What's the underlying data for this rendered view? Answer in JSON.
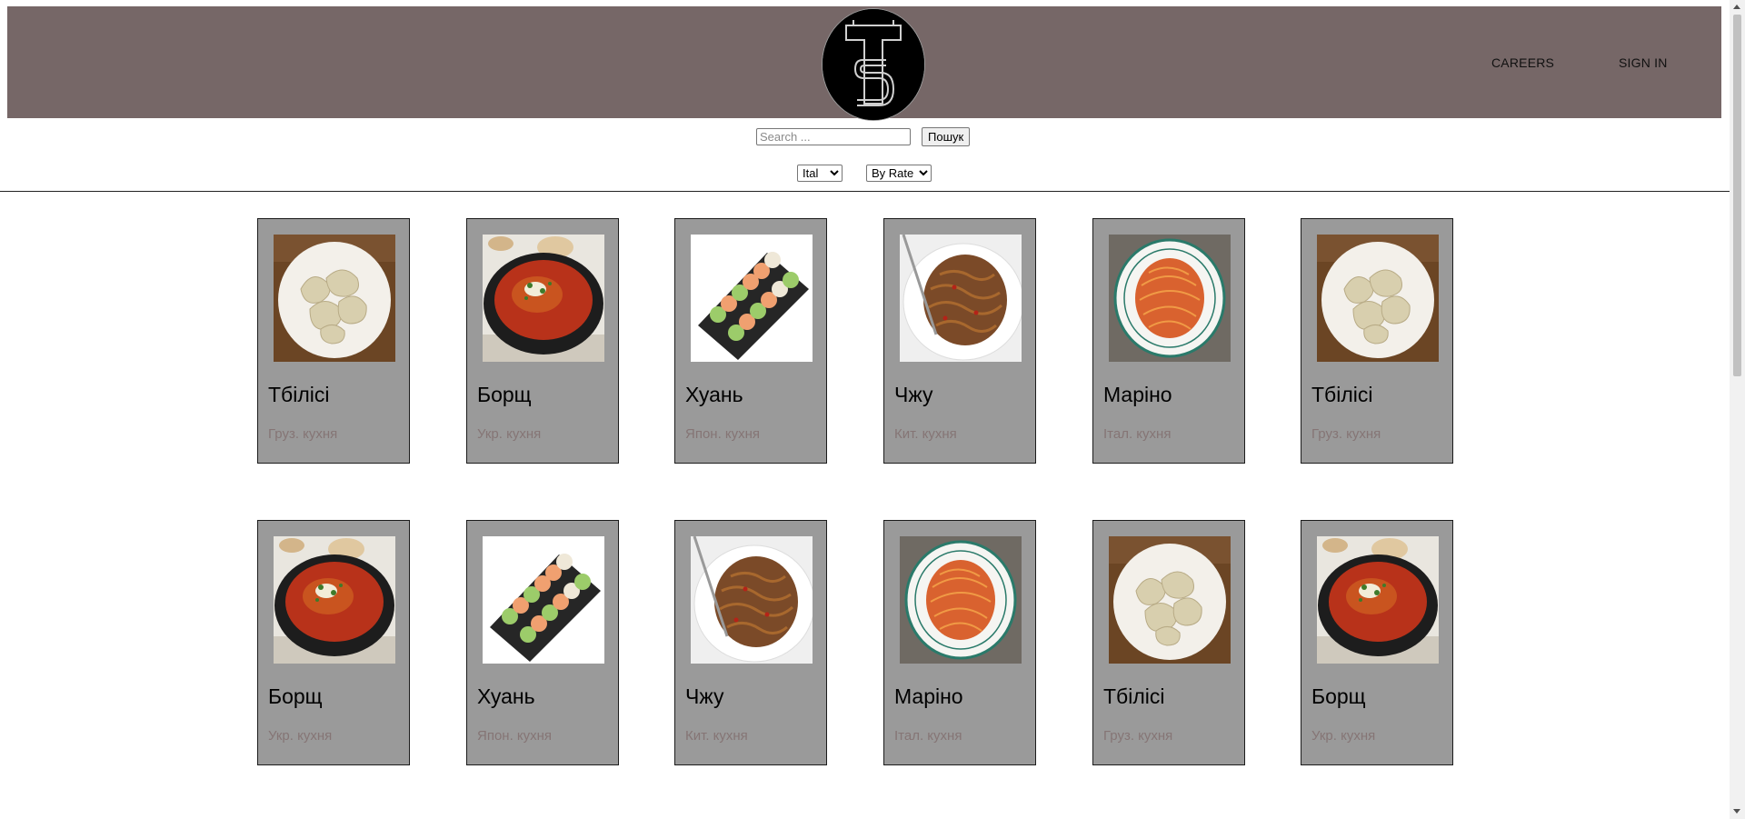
{
  "header": {
    "logo_alt": "TS logo",
    "nav": [
      {
        "label": "CAREERS"
      },
      {
        "label": "SIGN IN"
      }
    ]
  },
  "search": {
    "placeholder": "Search ...",
    "value": "",
    "button_label": "Пошук"
  },
  "filters": {
    "cuisine_selected": "Ital",
    "sort_selected": "By Rate"
  },
  "cards": [
    {
      "title": "Тбілісі",
      "subtitle": "Груз. кухня",
      "image": "dumplings"
    },
    {
      "title": "Борщ",
      "subtitle": "Укр. кухня",
      "image": "borscht"
    },
    {
      "title": "Хуань",
      "subtitle": "Япон. кухня",
      "image": "sushi"
    },
    {
      "title": "Чжу",
      "subtitle": "Кит. кухня",
      "image": "noodles"
    },
    {
      "title": "Маріно",
      "subtitle": "Італ. кухня",
      "image": "spaghetti"
    },
    {
      "title": "Тбілісі",
      "subtitle": "Груз. кухня",
      "image": "dumplings"
    },
    {
      "title": "Борщ",
      "subtitle": "Укр. кухня",
      "image": "borscht"
    },
    {
      "title": "Хуань",
      "subtitle": "Япон. кухня",
      "image": "sushi"
    },
    {
      "title": "Чжу",
      "subtitle": "Кит. кухня",
      "image": "noodles"
    },
    {
      "title": "Маріно",
      "subtitle": "Італ. кухня",
      "image": "spaghetti"
    },
    {
      "title": "Тбілісі",
      "subtitle": "Груз. кухня",
      "image": "dumplings"
    },
    {
      "title": "Борщ",
      "subtitle": "Укр. кухня",
      "image": "borscht"
    }
  ],
  "colors": {
    "header_bg": "#766767",
    "card_bg": "#9a9a9a",
    "subtitle": "#857575"
  }
}
